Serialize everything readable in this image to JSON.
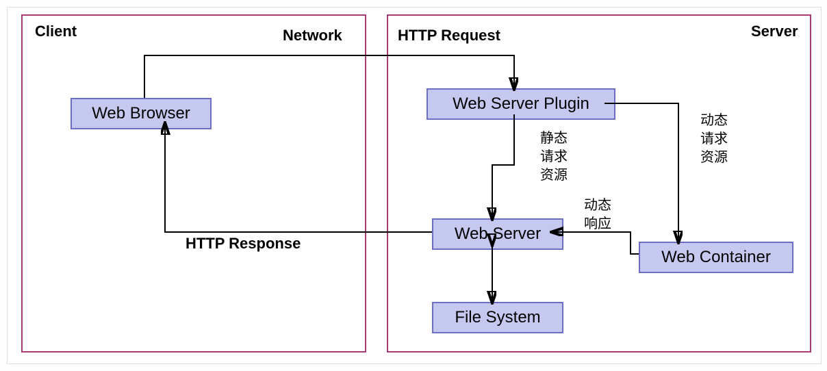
{
  "frames": {
    "client": {
      "label": "Client"
    },
    "server": {
      "label": "Server"
    }
  },
  "boxes": {
    "browser": "Web Browser",
    "plugin": "Web Server Plugin",
    "webserver": "Web Server",
    "container": "Web Container",
    "filesystem": "File System"
  },
  "labels": {
    "network": "Network",
    "http_request": "HTTP Request",
    "http_response": "HTTP Response",
    "static_req": "静态\n请求\n资源",
    "dynamic_req": "动态\n请求\n资源",
    "dynamic_resp": "动态\n响应"
  }
}
